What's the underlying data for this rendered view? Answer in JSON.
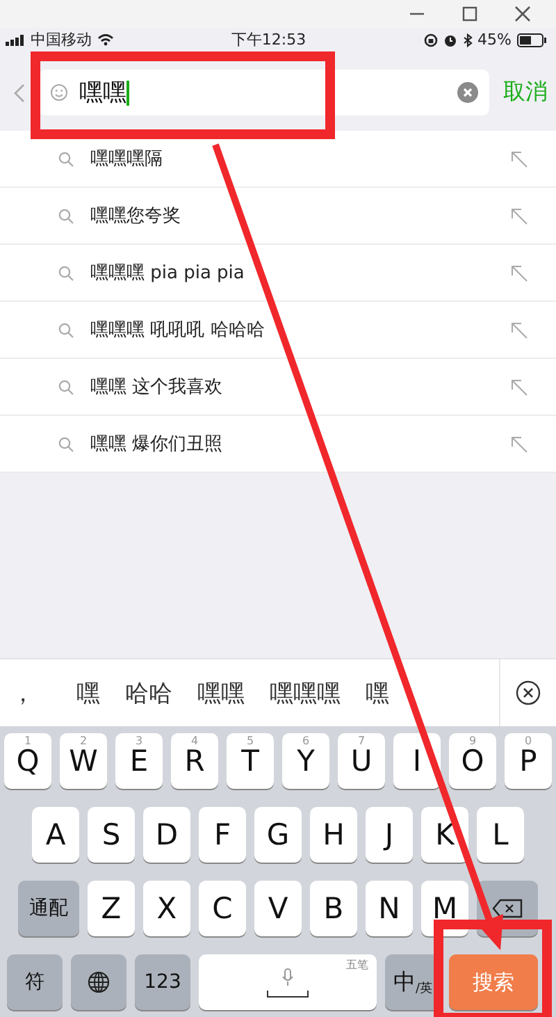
{
  "status_bar": {
    "carrier": "中国移动",
    "time": "下午12:53",
    "battery": "45%"
  },
  "search": {
    "value": "嘿嘿",
    "cancel": "取消"
  },
  "suggestions": [
    {
      "text": "嘿嘿嘿隔"
    },
    {
      "text": "嘿嘿您夸奖"
    },
    {
      "text": "嘿嘿嘿 pia pia pia"
    },
    {
      "text": "嘿嘿嘿 吼吼吼 哈哈哈"
    },
    {
      "text": "嘿嘿 这个我喜欢"
    },
    {
      "text": "嘿嘿 爆你们丑照"
    }
  ],
  "candidates": [
    "，",
    "嘿",
    "哈哈",
    "嘿嘿",
    "嘿嘿嘿",
    "嘿"
  ],
  "keyboard": [
    [
      {
        "kind": "letter",
        "label": "Q",
        "hint": "1"
      },
      {
        "kind": "letter",
        "label": "W",
        "hint": "2"
      },
      {
        "kind": "letter",
        "label": "E",
        "hint": "3"
      },
      {
        "kind": "letter",
        "label": "R",
        "hint": "4"
      },
      {
        "kind": "letter",
        "label": "T",
        "hint": "5"
      },
      {
        "kind": "letter",
        "label": "Y",
        "hint": "6"
      },
      {
        "kind": "letter",
        "label": "U",
        "hint": "7"
      },
      {
        "kind": "letter",
        "label": "I"
      },
      {
        "kind": "letter",
        "label": "O",
        "hint": "9"
      },
      {
        "kind": "letter",
        "label": "P",
        "hint": "0"
      }
    ],
    [
      {
        "kind": "letter",
        "label": "A"
      },
      {
        "kind": "letter",
        "label": "S"
      },
      {
        "kind": "letter",
        "label": "D"
      },
      {
        "kind": "letter",
        "label": "F"
      },
      {
        "kind": "letter",
        "label": "G"
      },
      {
        "kind": "letter",
        "label": "H"
      },
      {
        "kind": "letter",
        "label": "J"
      },
      {
        "kind": "letter",
        "label": "K"
      },
      {
        "kind": "letter",
        "label": "L"
      }
    ],
    [
      {
        "kind": "function",
        "label": "通配"
      },
      {
        "kind": "letter",
        "label": "Z"
      },
      {
        "kind": "letter",
        "label": "X"
      },
      {
        "kind": "letter",
        "label": "C"
      },
      {
        "kind": "letter",
        "label": "V"
      },
      {
        "kind": "letter",
        "label": "B"
      },
      {
        "kind": "letter",
        "label": "N"
      },
      {
        "kind": "letter",
        "label": "M"
      },
      {
        "kind": "delete"
      }
    ],
    [
      {
        "kind": "function",
        "label": "符"
      },
      {
        "kind": "globe"
      },
      {
        "kind": "function",
        "label": "123"
      },
      {
        "kind": "space",
        "hint": "五笔"
      },
      {
        "kind": "lang",
        "label": "中",
        "sub": "/英"
      },
      {
        "kind": "action",
        "label": "搜索"
      }
    ]
  ]
}
